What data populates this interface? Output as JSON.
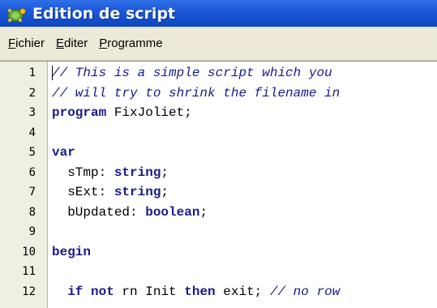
{
  "window": {
    "title": "Edition de script"
  },
  "menu": [
    {
      "mnemonic": "F",
      "rest": "ichier"
    },
    {
      "mnemonic": "E",
      "rest": "diter"
    },
    {
      "mnemonic": "P",
      "rest": "rogramme"
    }
  ],
  "editor": {
    "lines": [
      {
        "number": "1",
        "tokens": [
          {
            "t": "// This is a simple script which you",
            "c": "cm"
          }
        ]
      },
      {
        "number": "2",
        "tokens": [
          {
            "t": "// will try to shrink the filename in",
            "c": "cm"
          }
        ]
      },
      {
        "number": "3",
        "tokens": [
          {
            "t": "program",
            "c": "kw"
          },
          {
            "t": " FixJoliet;",
            "c": ""
          }
        ]
      },
      {
        "number": "4",
        "tokens": []
      },
      {
        "number": "5",
        "tokens": [
          {
            "t": "var",
            "c": "kw"
          }
        ]
      },
      {
        "number": "6",
        "tokens": [
          {
            "t": "  sTmp: ",
            "c": ""
          },
          {
            "t": "string",
            "c": "kw"
          },
          {
            "t": ";",
            "c": ""
          }
        ]
      },
      {
        "number": "7",
        "tokens": [
          {
            "t": "  sExt: ",
            "c": ""
          },
          {
            "t": "string",
            "c": "kw"
          },
          {
            "t": ";",
            "c": ""
          }
        ]
      },
      {
        "number": "8",
        "tokens": [
          {
            "t": "  bUpdated: ",
            "c": ""
          },
          {
            "t": "boolean",
            "c": "kw"
          },
          {
            "t": ";",
            "c": ""
          }
        ]
      },
      {
        "number": "9",
        "tokens": []
      },
      {
        "number": "10",
        "tokens": [
          {
            "t": "begin",
            "c": "kw"
          }
        ]
      },
      {
        "number": "11",
        "tokens": []
      },
      {
        "number": "12",
        "tokens": [
          {
            "t": "  ",
            "c": ""
          },
          {
            "t": "if",
            "c": "kw"
          },
          {
            "t": " ",
            "c": ""
          },
          {
            "t": "not",
            "c": "kw"
          },
          {
            "t": " rn Init ",
            "c": ""
          },
          {
            "t": "then",
            "c": "kw"
          },
          {
            "t": " exit; ",
            "c": ""
          },
          {
            "t": "// no row",
            "c": "cm"
          }
        ]
      }
    ]
  },
  "colors": {
    "titlebar": "#1a56d6",
    "menubar": "#ece9d8",
    "gutter": "#f0efe4",
    "keyword": "#1a1a8a",
    "comment": "#1a1a8a"
  }
}
